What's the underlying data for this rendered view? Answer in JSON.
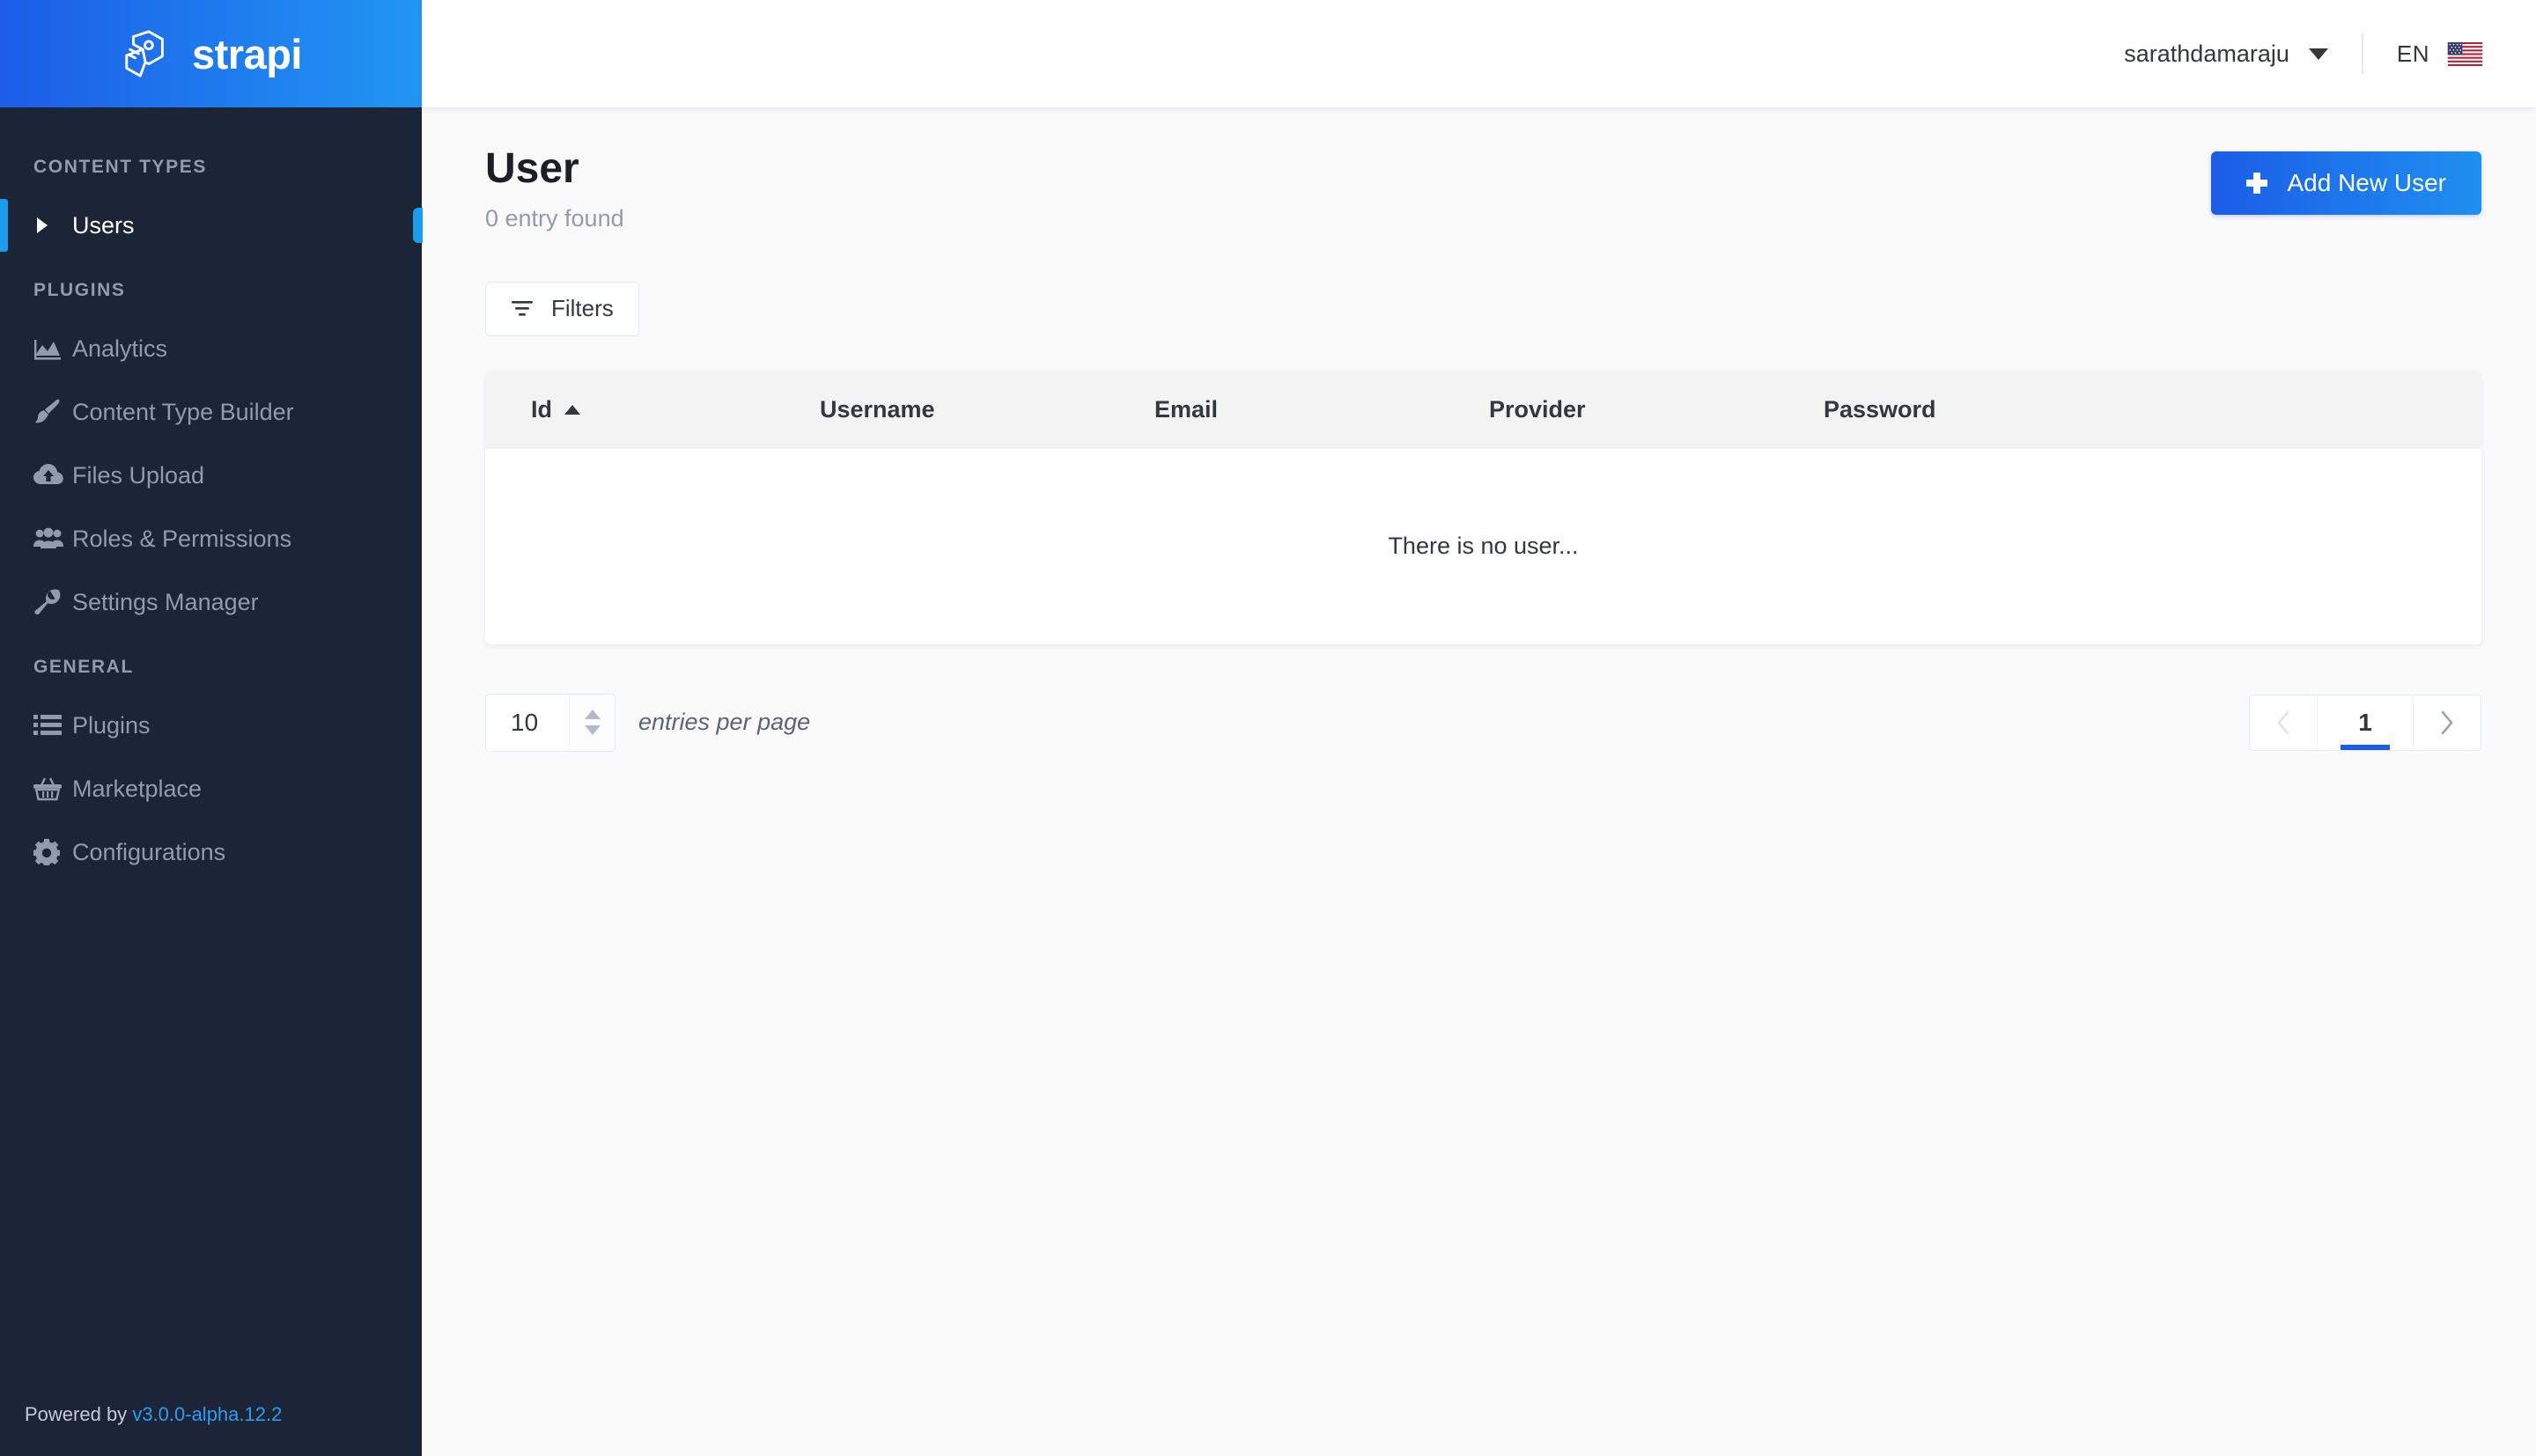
{
  "brand": {
    "name": "strapi",
    "logo_icon": "strapi-logo-icon"
  },
  "sidebar": {
    "sections": [
      {
        "label": "CONTENT TYPES",
        "items": [
          {
            "label": "Users",
            "icon": "caret-right-icon",
            "active": true
          }
        ]
      },
      {
        "label": "PLUGINS",
        "items": [
          {
            "label": "Analytics",
            "icon": "chart-area-icon",
            "active": false
          },
          {
            "label": "Content Type Builder",
            "icon": "paint-brush-icon",
            "active": false
          },
          {
            "label": "Files Upload",
            "icon": "cloud-upload-icon",
            "active": false
          },
          {
            "label": "Roles & Permissions",
            "icon": "users-group-icon",
            "active": false
          },
          {
            "label": "Settings Manager",
            "icon": "wrench-icon",
            "active": false
          }
        ]
      },
      {
        "label": "GENERAL",
        "items": [
          {
            "label": "Plugins",
            "icon": "list-icon",
            "active": false
          },
          {
            "label": "Marketplace",
            "icon": "shopping-basket-icon",
            "active": false
          },
          {
            "label": "Configurations",
            "icon": "gear-icon",
            "active": false
          }
        ]
      }
    ],
    "footer": {
      "prefix": "Powered by",
      "version": "v3.0.0-alpha.12.2"
    }
  },
  "topbar": {
    "username": "sarathdamaraju",
    "dropdown_icon": "chevron-down-icon",
    "language": "EN",
    "flag_icon": "us-flag-icon"
  },
  "page": {
    "title": "User",
    "entry_count": "0 entry found",
    "add_button": "Add New User",
    "add_button_icon": "plus-icon",
    "filters_button": "Filters",
    "filters_icon": "filter-funnel-icon"
  },
  "table": {
    "columns": [
      {
        "label": "Id",
        "sorted": "asc",
        "sort_icon": "sort-asc-icon"
      },
      {
        "label": "Username",
        "sorted": ""
      },
      {
        "label": "Email",
        "sorted": ""
      },
      {
        "label": "Provider",
        "sorted": ""
      },
      {
        "label": "Password",
        "sorted": ""
      }
    ],
    "rows": [],
    "empty_message": "There is no user..."
  },
  "pagination": {
    "per_page_value": "10",
    "per_page_label": "entries per page",
    "prev_icon": "chevron-left-icon",
    "next_icon": "chevron-right-icon",
    "current_page": "1",
    "prev_disabled": true
  },
  "colors": {
    "sidebar_bg": "#1c2538",
    "brand_gradient_start": "#1c5de7",
    "brand_gradient_end": "#2196f3",
    "accent": "#1c9ced",
    "primary_button": "#1c5de7",
    "content_bg": "#fafafb",
    "table_header_bg": "#f3f3f4",
    "muted_text": "#919bac"
  }
}
